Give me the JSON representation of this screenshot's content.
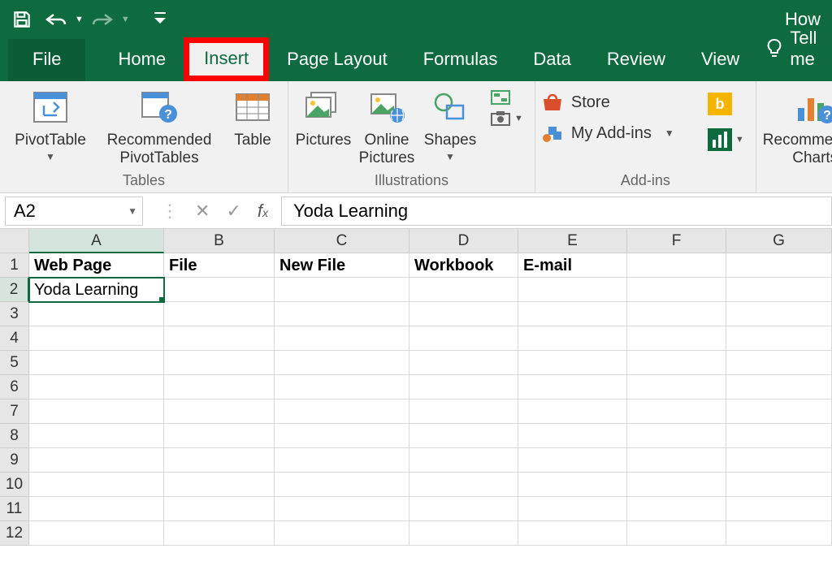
{
  "titlebar": {
    "title_right": "How"
  },
  "tabs": {
    "file": "File",
    "home": "Home",
    "insert": "Insert",
    "page_layout": "Page Layout",
    "formulas": "Formulas",
    "data": "Data",
    "review": "Review",
    "view": "View",
    "tell_me": "Tell me"
  },
  "ribbon": {
    "tables": {
      "pivot_table": "PivotTable",
      "recommended_pivot": "Recommended\nPivotTables",
      "table": "Table",
      "group_label": "Tables"
    },
    "illustrations": {
      "pictures": "Pictures",
      "online_pictures": "Online\nPictures",
      "shapes": "Shapes",
      "group_label": "Illustrations"
    },
    "addins": {
      "store": "Store",
      "my_addins": "My Add-ins",
      "group_label": "Add-ins"
    },
    "charts": {
      "recommended_charts": "Recommended\nCharts"
    }
  },
  "formulabar": {
    "namebox": "A2",
    "value": "Yoda Learning"
  },
  "columns": [
    "A",
    "B",
    "C",
    "D",
    "E",
    "F",
    "G"
  ],
  "rows": [
    "1",
    "2",
    "3",
    "4",
    "5",
    "6",
    "7",
    "8",
    "9",
    "10",
    "11",
    "12"
  ],
  "cells": {
    "A1": "Web Page",
    "B1": "File",
    "C1": "New File",
    "D1": "Workbook",
    "E1": "E-mail",
    "A2": "Yoda Learning"
  },
  "selected_cell": "A2"
}
